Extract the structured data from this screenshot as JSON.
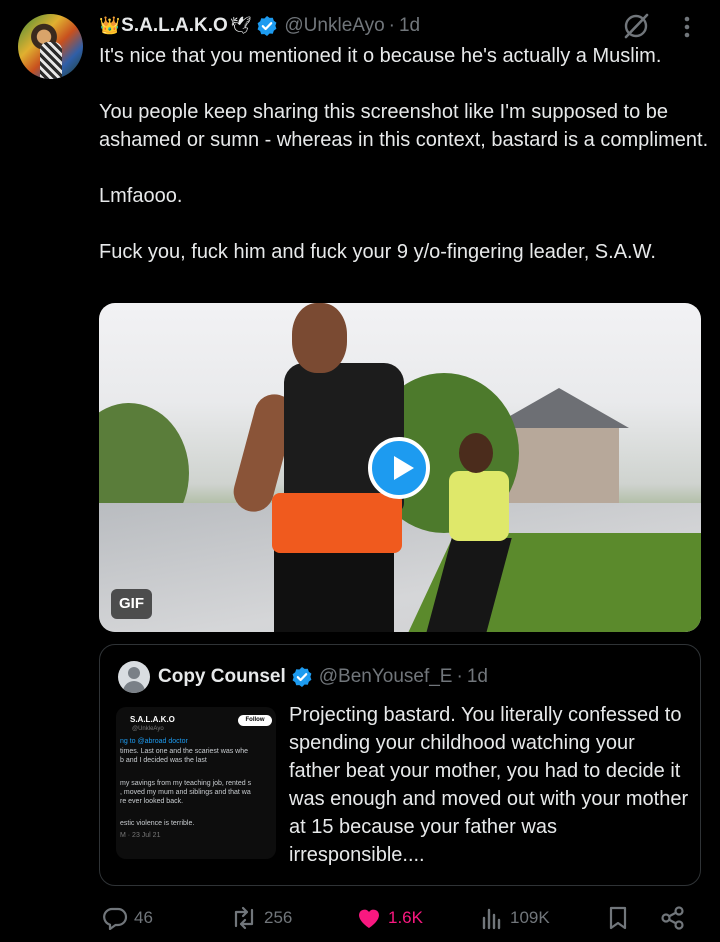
{
  "post": {
    "author": {
      "display_name": "S.A.L.A.K.O",
      "handle": "@UnkleAyo",
      "time": "1d",
      "verified": true,
      "emoji_prefix": "👑",
      "emoji_suffix": "🕊"
    },
    "text_lines": [
      "It's nice that you mentioned it o because he's actually a Muslim.",
      "",
      "You people keep sharing this screenshot like I'm supposed to be ashamed or sumn - whereas in this context, bastard is a compliment.",
      "",
      "Lmfaooo.",
      "",
      "Fuck you, fuck him and fuck your 9 y/o-fingering leader, S.A.W."
    ],
    "media": {
      "badge": "GIF",
      "play_icon": "play-icon"
    },
    "quoted": {
      "display_name": "Copy Counsel",
      "handle": "@BenYousef_E",
      "time": "1d",
      "verified": true,
      "text": "Projecting bastard.  You  literally confessed to spending your childhood watching your father beat your mother, you had to decide it was enough and moved out with your mother at 15 because your father was irresponsible....",
      "thumbnail": {
        "name": "S.A.L.A.K.O",
        "handle": "@UnkleAyo",
        "follow": "Follow",
        "reply_to": "ng to @abroad doctor",
        "lines": [
          "times. Last one and the scariest was whe",
          "b and I decided was the last",
          "",
          "my savings from my teaching job, rented s",
          ", moved my mum and siblings and that wa",
          "re ever looked back.",
          "",
          "estic violence is terrible."
        ],
        "date": "M · 23 Jul 21"
      }
    },
    "actions": {
      "replies": "46",
      "reposts": "256",
      "likes": "1.6K",
      "views": "109K"
    },
    "colors": {
      "background": "#000000",
      "text": "#e7e9ea",
      "muted": "#71767b",
      "accent": "#1d9bf0",
      "like": "#f91880",
      "border": "#2f3336"
    }
  }
}
